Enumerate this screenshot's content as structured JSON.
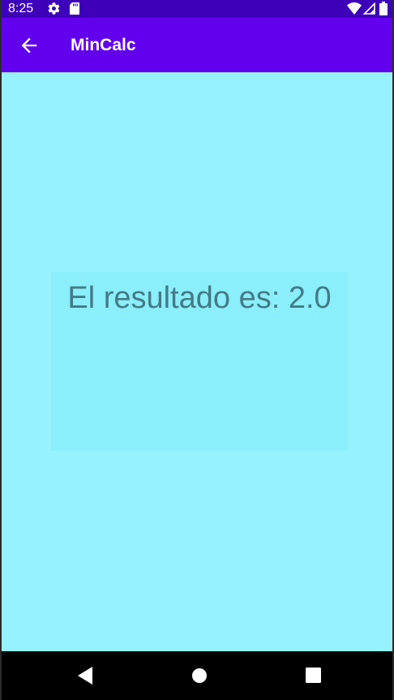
{
  "status_bar": {
    "time": "8:25",
    "icons": [
      "gear-icon",
      "sd-card-icon",
      "wifi-icon",
      "signal-icon",
      "battery-icon"
    ]
  },
  "app_bar": {
    "title": "MinCalc",
    "back_icon": "arrow-left-icon"
  },
  "content": {
    "result_text": "El resultado es: 2.0"
  },
  "nav_bar": {
    "icons": [
      "nav-back-icon",
      "nav-home-icon",
      "nav-recents-icon"
    ]
  },
  "colors": {
    "status_bar": "#3d00b8",
    "app_bar": "#6200ee",
    "background": "#95f2fe",
    "result_box": "#8aeefb",
    "result_text": "#437b86",
    "nav_bar": "#000000"
  }
}
